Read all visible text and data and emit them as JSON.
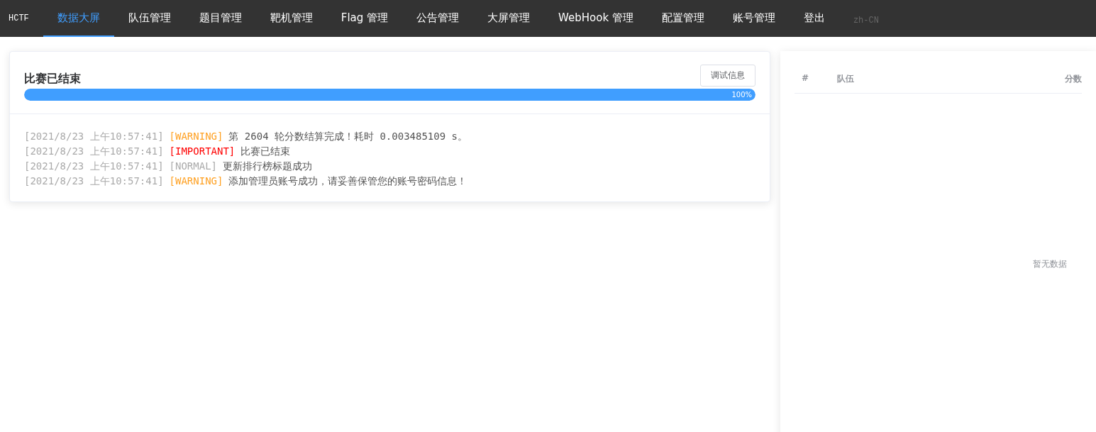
{
  "nav": {
    "brand": "HCTF",
    "items": [
      {
        "label": "数据大屏",
        "selected": true
      },
      {
        "label": "队伍管理",
        "selected": false
      },
      {
        "label": "题目管理",
        "selected": false
      },
      {
        "label": "靶机管理",
        "selected": false
      },
      {
        "label": "Flag 管理",
        "selected": false
      },
      {
        "label": "公告管理",
        "selected": false
      },
      {
        "label": "大屏管理",
        "selected": false
      },
      {
        "label": "WebHook 管理",
        "selected": false
      },
      {
        "label": "配置管理",
        "selected": false
      },
      {
        "label": "账号管理",
        "selected": false
      },
      {
        "label": "登出",
        "selected": false
      }
    ],
    "language": {
      "label": "zh-CN",
      "selected": false
    }
  },
  "status": {
    "title": "比赛已结束",
    "button": "调试信息",
    "level": 1,
    "reading": "100%"
  },
  "logs": [
    {
      "time": "[2021/8/23 上午10:57:41]",
      "kind": "warning",
      "tag": "[WARNING]",
      "message": "第 2604 轮分数结算完成！耗时 0.003485109 s。"
    },
    {
      "time": "[2021/8/23 上午10:57:41]",
      "kind": "important",
      "tag": "[IMPORTANT]",
      "message": "比赛已结束"
    },
    {
      "time": "[2021/8/23 上午10:57:41]",
      "kind": "normal",
      "tag": "[NORMAL]",
      "message": "更新排行榜标题成功"
    },
    {
      "time": "[2021/8/23 上午10:57:41]",
      "kind": "warning",
      "tag": "[WARNING]",
      "message": "添加管理员账号成功，请妥善保管您的账号密码信息！"
    }
  ],
  "ranking": {
    "columns": [
      "#",
      "队伍",
      "分数"
    ],
    "empty": "暂无数据"
  }
}
